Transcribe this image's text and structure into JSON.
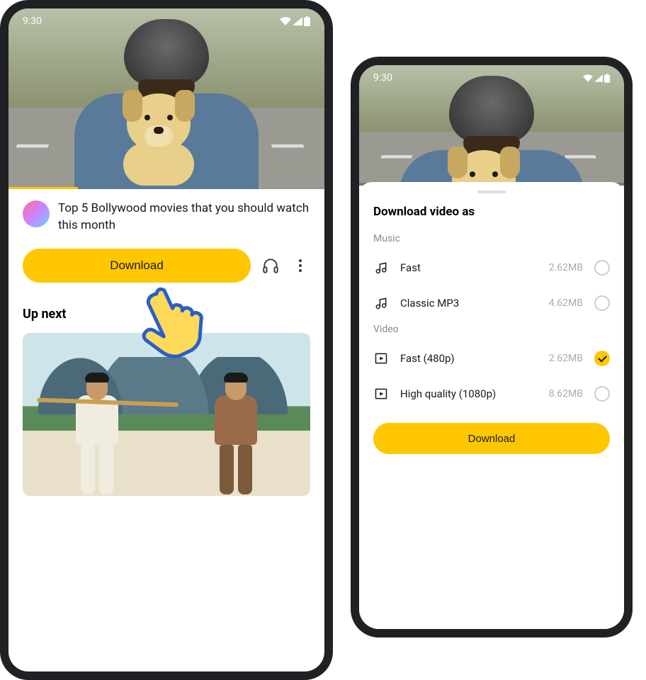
{
  "status": {
    "time": "9:30"
  },
  "left": {
    "video_title": "Top 5 Bollywood movies that you should watch this month",
    "download_label": "Download",
    "upnext_heading": "Up next"
  },
  "right": {
    "sheet_title": "Download video as",
    "group_music": "Music",
    "group_video": "Video",
    "music_options": [
      {
        "label": "Fast",
        "size": "2.62MB",
        "checked": false
      },
      {
        "label": "Classic MP3",
        "size": "4.62MB",
        "checked": false
      }
    ],
    "video_options": [
      {
        "label": "Fast (480p)",
        "size": "2.62MB",
        "checked": true
      },
      {
        "label": "High quality (1080p)",
        "size": "8.62MB",
        "checked": false
      }
    ],
    "download_label": "Download"
  }
}
